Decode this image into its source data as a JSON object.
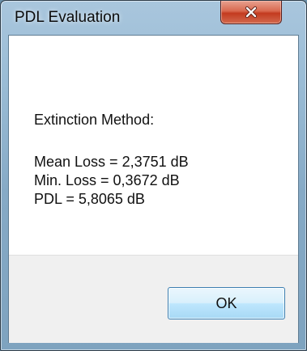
{
  "window": {
    "title": "PDL Evaluation",
    "close_icon": "close-icon"
  },
  "message": {
    "heading": "Extinction Method:",
    "lines": [
      "Mean Loss = 2,3751 dB",
      "Min. Loss = 0,3672 dB",
      "PDL = 5,8065 dB"
    ]
  },
  "buttons": {
    "ok_label": "OK"
  },
  "colors": {
    "close_button": "#c33a1f",
    "ok_button_border": "#3c7fb1"
  }
}
